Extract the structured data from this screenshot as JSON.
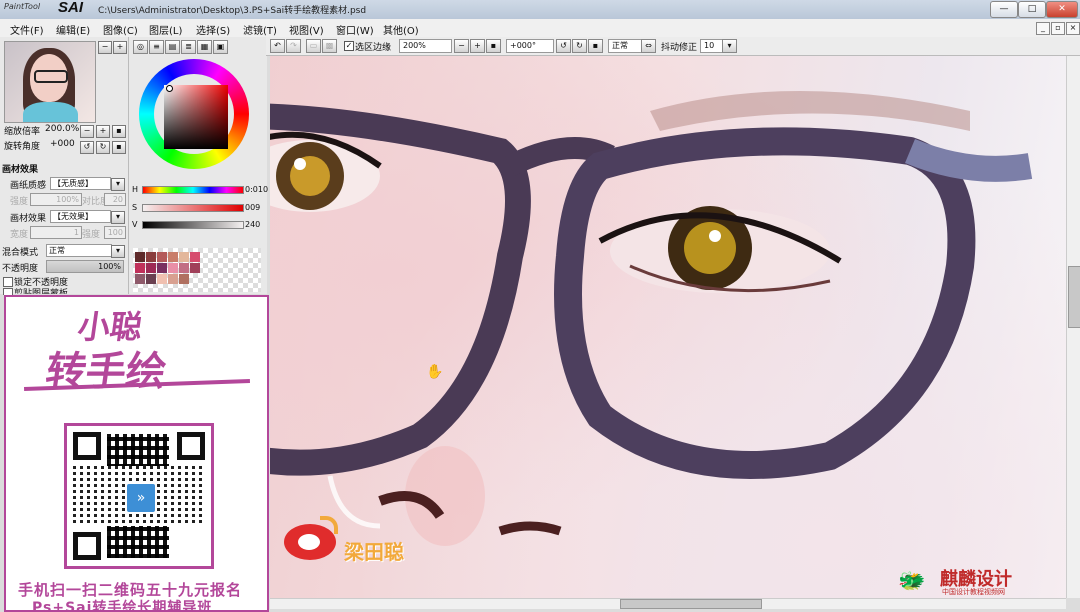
{
  "window": {
    "logo_small": "PaintTool",
    "logo_big": "SAI",
    "path": "C:\\Users\\Administrator\\Desktop\\3.PS+Sai转手绘教程素材.psd",
    "minimize": "—",
    "maximize": "□",
    "close": "✕"
  },
  "menu": {
    "items": [
      "文件(F)",
      "编辑(E)",
      "图像(C)",
      "图层(L)",
      "选择(S)",
      "滤镜(T)",
      "视图(V)",
      "窗口(W)",
      "其他(O)"
    ]
  },
  "navigator": {
    "zoom_label": "缩放倍率",
    "zoom_value": "200.0%",
    "rotate_label": "旋转角度",
    "rotate_value": "+000"
  },
  "texture": {
    "section": "画材效果",
    "paper_label": "画纸质感",
    "paper_value": "【无质感】",
    "strength1_label": "强度",
    "strength1_value": "100%",
    "contrast_label": "对比度",
    "contrast_value": "20",
    "effect_label": "画材效果",
    "effect_value": "【无效果】",
    "width_label": "宽度",
    "width_value": "1",
    "strength2_label": "强度",
    "strength2_value": "100"
  },
  "layer": {
    "blend_label": "混合模式",
    "blend_value": "正常",
    "opacity_label": "不透明度",
    "opacity_value": "100%",
    "lock_label": "锁定不透明度",
    "clip_label": "剪贴图层蒙板"
  },
  "color": {
    "h_label": "H",
    "h_value": "0:010",
    "s_label": "S",
    "s_value": "009",
    "v_label": "V",
    "v_value": "240",
    "swatches": [
      "#5e2a2a",
      "#8a3d3d",
      "#b45a5a",
      "#c97d6a",
      "#e3b79b",
      "#d64d6e",
      "#c0305a",
      "#9e2a55",
      "#7a3060",
      "#e98fa7",
      "#c26e84",
      "#a0405a",
      "#8e5a6a",
      "#6a4050",
      "#f0c0b0",
      "#d8a090",
      "#b07060"
    ],
    "accent": "#e00000"
  },
  "toolbar": {
    "zoom": "200%",
    "selection_edge": "选区边缘",
    "rotation": "+000°",
    "mode": "正常",
    "stabilizer_label": "抖动修正",
    "stabilizer_value": "10"
  },
  "ad": {
    "logo_line1": "小聪",
    "logo_line2": "转手绘",
    "footer1": "手机扫一扫二维码五十九元报名",
    "footer2": "Ps+Sai转手绘长期辅导班",
    "accent": "#b3479a"
  },
  "watermarks": {
    "weibo_name": "梁田聪",
    "brand": "麒麟设计",
    "brand_sub": "中国设计教程视频网"
  }
}
